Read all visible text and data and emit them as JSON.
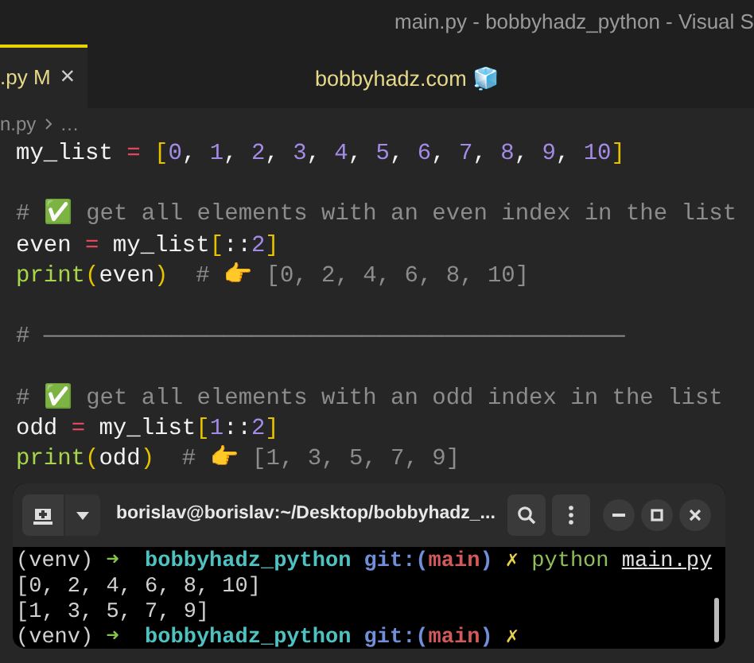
{
  "window": {
    "title": "main.py - bobbyhadz_python - Visual S"
  },
  "tabs": [
    {
      "label": ".py",
      "badge": "M",
      "close": "×",
      "selected": true
    }
  ],
  "banner": {
    "text": "bobbyhadz.com 🧊"
  },
  "breadcrumb": [
    "n.py",
    "…"
  ],
  "code_blocks": [
    [
      [
        {
          "kind": "plain",
          "text": "my_list "
        },
        {
          "kind": "op",
          "text": "= "
        },
        {
          "kind": "bracket",
          "text": "["
        },
        {
          "kind": "num",
          "text": "0"
        },
        {
          "kind": "plain",
          "text": ", "
        },
        {
          "kind": "num",
          "text": "1"
        },
        {
          "kind": "plain",
          "text": ", "
        },
        {
          "kind": "num",
          "text": "2"
        },
        {
          "kind": "plain",
          "text": ", "
        },
        {
          "kind": "num",
          "text": "3"
        },
        {
          "kind": "plain",
          "text": ", "
        },
        {
          "kind": "num",
          "text": "4"
        },
        {
          "kind": "plain",
          "text": ", "
        },
        {
          "kind": "num",
          "text": "5"
        },
        {
          "kind": "plain",
          "text": ", "
        },
        {
          "kind": "num",
          "text": "6"
        },
        {
          "kind": "plain",
          "text": ", "
        },
        {
          "kind": "num",
          "text": "7"
        },
        {
          "kind": "plain",
          "text": ", "
        },
        {
          "kind": "num",
          "text": "8"
        },
        {
          "kind": "plain",
          "text": ", "
        },
        {
          "kind": "num",
          "text": "9"
        },
        {
          "kind": "plain",
          "text": ", "
        },
        {
          "kind": "num",
          "text": "10"
        },
        {
          "kind": "bracket",
          "text": "]"
        }
      ]
    ],
    [
      [
        {
          "kind": "comment",
          "text": "# ✅ get all elements with an even index in the list"
        }
      ],
      [
        {
          "kind": "plain",
          "text": "even "
        },
        {
          "kind": "op",
          "text": "="
        },
        {
          "kind": "plain",
          "text": " my_list"
        },
        {
          "kind": "bracket",
          "text": "["
        },
        {
          "kind": "plain",
          "text": "::"
        },
        {
          "kind": "num",
          "text": "2"
        },
        {
          "kind": "bracket",
          "text": "]"
        }
      ],
      [
        {
          "kind": "func",
          "text": "print"
        },
        {
          "kind": "bracket",
          "text": "("
        },
        {
          "kind": "plain",
          "text": "even"
        },
        {
          "kind": "bracket",
          "text": ")"
        },
        {
          "kind": "comment",
          "text": "  # 👉 [0, 2, 4, 6, 8, 10]"
        }
      ]
    ],
    [
      [
        {
          "kind": "comment",
          "text": "# ——————————————————————————————————————————"
        }
      ]
    ],
    [
      [
        {
          "kind": "comment",
          "text": "# ✅ get all elements with an odd index in the list"
        }
      ],
      [
        {
          "kind": "plain",
          "text": "odd "
        },
        {
          "kind": "op",
          "text": "="
        },
        {
          "kind": "plain",
          "text": " my_list"
        },
        {
          "kind": "bracket",
          "text": "["
        },
        {
          "kind": "num",
          "text": "1"
        },
        {
          "kind": "plain",
          "text": "::"
        },
        {
          "kind": "num",
          "text": "2"
        },
        {
          "kind": "bracket",
          "text": "]"
        }
      ],
      [
        {
          "kind": "func",
          "text": "print"
        },
        {
          "kind": "bracket",
          "text": "("
        },
        {
          "kind": "plain",
          "text": "odd"
        },
        {
          "kind": "bracket",
          "text": ")"
        },
        {
          "kind": "comment",
          "text": "  # 👉 [1, 3, 5, 7, 9]"
        }
      ]
    ]
  ],
  "terminal": {
    "title": "borislav@borislav:~/Desktop/bobbyhadz_...",
    "lines": [
      [
        {
          "kind": "venv",
          "text": "(venv) "
        },
        {
          "kind": "arrow",
          "text": "➜ "
        },
        {
          "kind": "dir",
          "text": " bobbyhadz_python "
        },
        {
          "kind": "git",
          "text": "git:("
        },
        {
          "kind": "branch",
          "text": "main"
        },
        {
          "kind": "git",
          "text": ")"
        },
        {
          "kind": "dirty",
          "text": " ✗ "
        },
        {
          "kind": "cmd",
          "text": "python "
        },
        {
          "kind": "arg",
          "text": "main.py"
        }
      ],
      [
        {
          "kind": "venv",
          "text": "[0, 2, 4, 6, 8, 10]"
        }
      ],
      [
        {
          "kind": "venv",
          "text": "[1, 3, 5, 7, 9]"
        }
      ],
      [
        {
          "kind": "venv",
          "text": "(venv) "
        },
        {
          "kind": "arrow",
          "text": "➜ "
        },
        {
          "kind": "dir",
          "text": " bobbyhadz_python "
        },
        {
          "kind": "git",
          "text": "git:("
        },
        {
          "kind": "branch",
          "text": "main"
        },
        {
          "kind": "git",
          "text": ")"
        },
        {
          "kind": "dirty",
          "text": " ✗"
        }
      ]
    ]
  }
}
